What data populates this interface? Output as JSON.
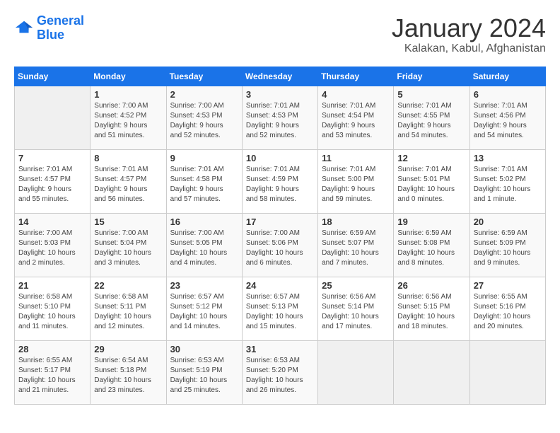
{
  "header": {
    "logo_line1": "General",
    "logo_line2": "Blue",
    "month": "January 2024",
    "location": "Kalakan, Kabul, Afghanistan"
  },
  "days_of_week": [
    "Sunday",
    "Monday",
    "Tuesday",
    "Wednesday",
    "Thursday",
    "Friday",
    "Saturday"
  ],
  "weeks": [
    [
      {
        "day": "",
        "info": ""
      },
      {
        "day": "1",
        "info": "Sunrise: 7:00 AM\nSunset: 4:52 PM\nDaylight: 9 hours\nand 51 minutes."
      },
      {
        "day": "2",
        "info": "Sunrise: 7:00 AM\nSunset: 4:53 PM\nDaylight: 9 hours\nand 52 minutes."
      },
      {
        "day": "3",
        "info": "Sunrise: 7:01 AM\nSunset: 4:53 PM\nDaylight: 9 hours\nand 52 minutes."
      },
      {
        "day": "4",
        "info": "Sunrise: 7:01 AM\nSunset: 4:54 PM\nDaylight: 9 hours\nand 53 minutes."
      },
      {
        "day": "5",
        "info": "Sunrise: 7:01 AM\nSunset: 4:55 PM\nDaylight: 9 hours\nand 54 minutes."
      },
      {
        "day": "6",
        "info": "Sunrise: 7:01 AM\nSunset: 4:56 PM\nDaylight: 9 hours\nand 54 minutes."
      }
    ],
    [
      {
        "day": "7",
        "info": "Sunrise: 7:01 AM\nSunset: 4:57 PM\nDaylight: 9 hours\nand 55 minutes."
      },
      {
        "day": "8",
        "info": "Sunrise: 7:01 AM\nSunset: 4:57 PM\nDaylight: 9 hours\nand 56 minutes."
      },
      {
        "day": "9",
        "info": "Sunrise: 7:01 AM\nSunset: 4:58 PM\nDaylight: 9 hours\nand 57 minutes."
      },
      {
        "day": "10",
        "info": "Sunrise: 7:01 AM\nSunset: 4:59 PM\nDaylight: 9 hours\nand 58 minutes."
      },
      {
        "day": "11",
        "info": "Sunrise: 7:01 AM\nSunset: 5:00 PM\nDaylight: 9 hours\nand 59 minutes."
      },
      {
        "day": "12",
        "info": "Sunrise: 7:01 AM\nSunset: 5:01 PM\nDaylight: 10 hours\nand 0 minutes."
      },
      {
        "day": "13",
        "info": "Sunrise: 7:01 AM\nSunset: 5:02 PM\nDaylight: 10 hours\nand 1 minute."
      }
    ],
    [
      {
        "day": "14",
        "info": "Sunrise: 7:00 AM\nSunset: 5:03 PM\nDaylight: 10 hours\nand 2 minutes."
      },
      {
        "day": "15",
        "info": "Sunrise: 7:00 AM\nSunset: 5:04 PM\nDaylight: 10 hours\nand 3 minutes."
      },
      {
        "day": "16",
        "info": "Sunrise: 7:00 AM\nSunset: 5:05 PM\nDaylight: 10 hours\nand 4 minutes."
      },
      {
        "day": "17",
        "info": "Sunrise: 7:00 AM\nSunset: 5:06 PM\nDaylight: 10 hours\nand 6 minutes."
      },
      {
        "day": "18",
        "info": "Sunrise: 6:59 AM\nSunset: 5:07 PM\nDaylight: 10 hours\nand 7 minutes."
      },
      {
        "day": "19",
        "info": "Sunrise: 6:59 AM\nSunset: 5:08 PM\nDaylight: 10 hours\nand 8 minutes."
      },
      {
        "day": "20",
        "info": "Sunrise: 6:59 AM\nSunset: 5:09 PM\nDaylight: 10 hours\nand 9 minutes."
      }
    ],
    [
      {
        "day": "21",
        "info": "Sunrise: 6:58 AM\nSunset: 5:10 PM\nDaylight: 10 hours\nand 11 minutes."
      },
      {
        "day": "22",
        "info": "Sunrise: 6:58 AM\nSunset: 5:11 PM\nDaylight: 10 hours\nand 12 minutes."
      },
      {
        "day": "23",
        "info": "Sunrise: 6:57 AM\nSunset: 5:12 PM\nDaylight: 10 hours\nand 14 minutes."
      },
      {
        "day": "24",
        "info": "Sunrise: 6:57 AM\nSunset: 5:13 PM\nDaylight: 10 hours\nand 15 minutes."
      },
      {
        "day": "25",
        "info": "Sunrise: 6:56 AM\nSunset: 5:14 PM\nDaylight: 10 hours\nand 17 minutes."
      },
      {
        "day": "26",
        "info": "Sunrise: 6:56 AM\nSunset: 5:15 PM\nDaylight: 10 hours\nand 18 minutes."
      },
      {
        "day": "27",
        "info": "Sunrise: 6:55 AM\nSunset: 5:16 PM\nDaylight: 10 hours\nand 20 minutes."
      }
    ],
    [
      {
        "day": "28",
        "info": "Sunrise: 6:55 AM\nSunset: 5:17 PM\nDaylight: 10 hours\nand 21 minutes."
      },
      {
        "day": "29",
        "info": "Sunrise: 6:54 AM\nSunset: 5:18 PM\nDaylight: 10 hours\nand 23 minutes."
      },
      {
        "day": "30",
        "info": "Sunrise: 6:53 AM\nSunset: 5:19 PM\nDaylight: 10 hours\nand 25 minutes."
      },
      {
        "day": "31",
        "info": "Sunrise: 6:53 AM\nSunset: 5:20 PM\nDaylight: 10 hours\nand 26 minutes."
      },
      {
        "day": "",
        "info": ""
      },
      {
        "day": "",
        "info": ""
      },
      {
        "day": "",
        "info": ""
      }
    ]
  ]
}
